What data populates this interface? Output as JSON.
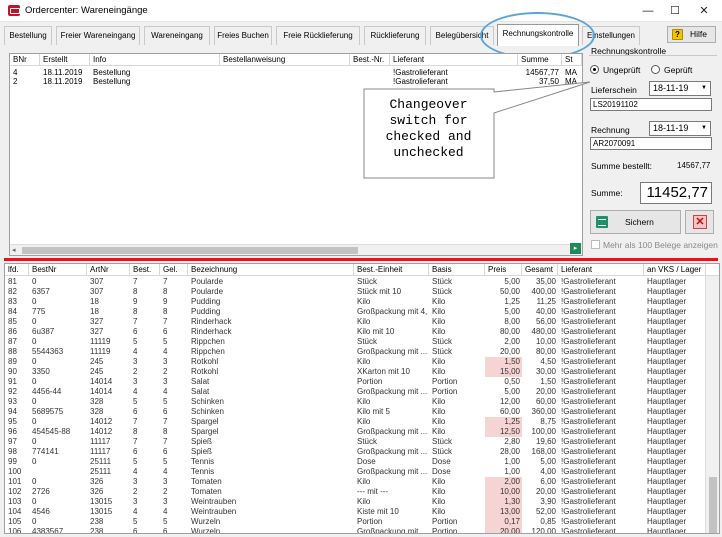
{
  "window": {
    "title": "Ordercenter: Wareneingänge",
    "minimize": "—",
    "maximize": "☐",
    "close": "✕"
  },
  "tabs": [
    {
      "label": "Bestellung"
    },
    {
      "label": "Freier Wareneingang"
    },
    {
      "label": "Wareneingang"
    },
    {
      "label": "Freies Buchen"
    },
    {
      "label": "Freie Rücklieferung"
    },
    {
      "label": "Rücklieferung"
    },
    {
      "label": "Belegübersicht"
    },
    {
      "label": "Rechnungskontrolle"
    },
    {
      "label": "Einstellungen"
    }
  ],
  "help": {
    "label": "Hilfe",
    "icon": "?"
  },
  "upper_grid": {
    "columns": [
      "BNr",
      "Erstellt",
      "Info",
      "Bestellanweisung",
      "Best.-Nr.",
      "Lieferant",
      "Summe",
      "St"
    ],
    "rows": [
      [
        "4",
        "18.11.2019",
        "Bestellung",
        "",
        "",
        "!Gastrolieferant",
        "14567,77",
        "MA"
      ],
      [
        "2",
        "18.11.2019",
        "Bestellung",
        "",
        "",
        "!Gastrolieferant",
        "37,50",
        "MA"
      ]
    ],
    "scroll_left": "◂",
    "nav_next": "▸"
  },
  "invoice_panel": {
    "title": "Rechnungskontrolle",
    "radio_unchecked_label": "Ungeprüft",
    "radio_checked_label": "Geprüft",
    "delivery_note_label": "Lieferschein",
    "delivery_note_date": "18-11-19",
    "delivery_note_number": "LS20191102",
    "invoice_label": "Rechnung",
    "invoice_date": "18-11-19",
    "invoice_number": "AR2070091",
    "sum_ordered_label": "Summe bestellt:",
    "sum_ordered_value": "14567,77",
    "sum_label": "Summe:",
    "sum_value": "11452,77",
    "save_label": "Sichern",
    "more_docs_label": "Mehr als 100 Belege anzeigen"
  },
  "callout": {
    "line1": "Changeover",
    "line2": "switch for",
    "line3": "checked and",
    "line4": "unchecked"
  },
  "lower_grid": {
    "columns": [
      "lfd.",
      "BestNr",
      "ArtNr",
      "Best.",
      "Gel.",
      "Bezeichnung",
      "Best.-Einheit",
      "Basis",
      "Preis",
      "Gesamt",
      "Lieferant",
      "an VKS / Lager"
    ],
    "rows": [
      [
        "81",
        "0",
        "307",
        "7",
        "7",
        "Poularde",
        "Stück",
        "Stück",
        "5,00",
        "35,00",
        "!Gastrolieferant",
        "Hauptlager"
      ],
      [
        "82",
        "6357",
        "307",
        "8",
        "8",
        "Poularde",
        "Stück mit 10",
        "Stück",
        "50,00",
        "400,00",
        "!Gastrolieferant",
        "Hauptlager"
      ],
      [
        "83",
        "0",
        "18",
        "9",
        "9",
        "Pudding",
        "Kilo",
        "Kilo",
        "1,25",
        "11,25",
        "!Gastrolieferant",
        "Hauptlager"
      ],
      [
        "84",
        "775",
        "18",
        "8",
        "8",
        "Pudding",
        "Großpackung mit 4,",
        "Kilo",
        "5,00",
        "40,00",
        "!Gastrolieferant",
        "Hauptlager"
      ],
      [
        "85",
        "0",
        "327",
        "7",
        "7",
        "Rinderhack",
        "Kilo",
        "Kilo",
        "8,00",
        "56,00",
        "!Gastrolieferant",
        "Hauptlager"
      ],
      [
        "86",
        "6u387",
        "327",
        "6",
        "6",
        "Rinderhack",
        "Kilo mit 10",
        "Kilo",
        "80,00",
        "480,00",
        "!Gastrolieferant",
        "Hauptlager"
      ],
      [
        "87",
        "0",
        "11119",
        "5",
        "5",
        "Rippchen",
        "Stück",
        "Stück",
        "2,00",
        "10,00",
        "!Gastrolieferant",
        "Hauptlager"
      ],
      [
        "88",
        "5544363",
        "11119",
        "4",
        "4",
        "Rippchen",
        "Großpackung mit ...",
        "Stück",
        "20,00",
        "80,00",
        "!Gastrolieferant",
        "Hauptlager"
      ],
      [
        "89",
        "0",
        "245",
        "3",
        "3",
        "Rotkohl",
        "Kilo",
        "Kilo",
        "1,50",
        "4,50",
        "!Gastrolieferant",
        "Hauptlager"
      ],
      [
        "90",
        "3350",
        "245",
        "2",
        "2",
        "Rotkohl",
        "XKarton mit 10",
        "Kilo",
        "15,00",
        "30,00",
        "!Gastrolieferant",
        "Hauptlager"
      ],
      [
        "91",
        "0",
        "14014",
        "3",
        "3",
        "Salat",
        "Portion",
        "Portion",
        "0,50",
        "1,50",
        "!Gastrolieferant",
        "Hauptlager"
      ],
      [
        "92",
        "4456-44",
        "14014",
        "4",
        "4",
        "Salat",
        "Großpackung mit ...",
        "Portion",
        "5,00",
        "20,00",
        "!Gastrolieferant",
        "Hauptlager"
      ],
      [
        "93",
        "0",
        "328",
        "5",
        "5",
        "Schinken",
        "Kilo",
        "Kilo",
        "12,00",
        "60,00",
        "!Gastrolieferant",
        "Hauptlager"
      ],
      [
        "94",
        "5689575",
        "328",
        "6",
        "6",
        "Schinken",
        "Kilo mit 5",
        "Kilo",
        "60,00",
        "360,00",
        "!Gastrolieferant",
        "Hauptlager"
      ],
      [
        "95",
        "0",
        "14012",
        "7",
        "7",
        "Spargel",
        "Kilo",
        "Kilo",
        "1,25",
        "8,75",
        "!Gastrolieferant",
        "Hauptlager"
      ],
      [
        "96",
        "454545-88",
        "14012",
        "8",
        "8",
        "Spargel",
        "Großpackung mit ...",
        "Kilo",
        "12,50",
        "100,00",
        "!Gastrolieferant",
        "Hauptlager"
      ],
      [
        "97",
        "0",
        "11117",
        "7",
        "7",
        "Spieß",
        "Stück",
        "Stück",
        "2,80",
        "19,60",
        "!Gastrolieferant",
        "Hauptlager"
      ],
      [
        "98",
        "774141",
        "11117",
        "6",
        "6",
        "Spieß",
        "Großpackung mit ...",
        "Stück",
        "28,00",
        "168,00",
        "!Gastrolieferant",
        "Hauptlager"
      ],
      [
        "99",
        "0",
        "25111",
        "5",
        "5",
        "Tennis",
        "Dose",
        "Dose",
        "1,00",
        "5,00",
        "!Gastrolieferant",
        "Hauptlager"
      ],
      [
        "100",
        "",
        "25111",
        "4",
        "4",
        "Tennis",
        "Großpackung mit ...",
        "Dose",
        "1,00",
        "4,00",
        "!Gastrolieferant",
        "Hauptlager"
      ],
      [
        "101",
        "0",
        "326",
        "3",
        "3",
        "Tomaten",
        "Kilo",
        "Kilo",
        "2,00",
        "6,00",
        "!Gastrolieferant",
        "Hauptlager"
      ],
      [
        "102",
        "2726",
        "326",
        "2",
        "2",
        "Tomaten",
        "--- mit ---",
        "Kilo",
        "10,00",
        "20,00",
        "!Gastrolieferant",
        "Hauptlager"
      ],
      [
        "103",
        "0",
        "13015",
        "3",
        "3",
        "Weintrauben",
        "Kilo",
        "Kilo",
        "1,30",
        "3,90",
        "!Gastrolieferant",
        "Hauptlager"
      ],
      [
        "104",
        "4546",
        "13015",
        "4",
        "4",
        "Weintrauben",
        "Kiste mit 10",
        "Kilo",
        "13,00",
        "52,00",
        "!Gastrolieferant",
        "Hauptlager"
      ],
      [
        "105",
        "0",
        "238",
        "5",
        "5",
        "Wurzeln",
        "Portion",
        "Portion",
        "0,17",
        "0,85",
        "!Gastrolieferant",
        "Hauptlager"
      ],
      [
        "106",
        "4383567",
        "238",
        "6",
        "6",
        "Wurzeln",
        "Großpackung mit ...",
        "Portion",
        "20,00",
        "120,00",
        "!Gastrolieferant",
        "Hauptlager"
      ]
    ],
    "pink_price_rows": [
      8,
      9,
      14,
      15,
      20,
      21,
      22,
      23,
      24,
      25
    ]
  },
  "colors": {
    "accent_red": "#e11111",
    "highlight_blue": "#5aa5d8",
    "price_highlight": "#f7d4d4",
    "save_icon_green": "#1e8f6a",
    "help_icon_yellow": "#f5c400"
  }
}
